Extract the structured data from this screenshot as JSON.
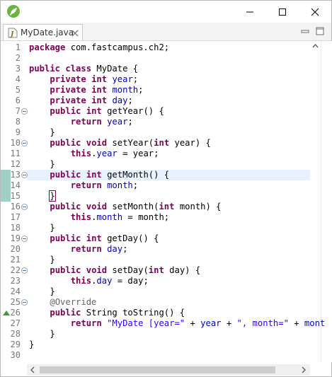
{
  "window": {
    "accent": "#6db33f"
  },
  "editor_tab": {
    "label": "MyDate.java"
  },
  "code_lines": [
    {
      "n": "1",
      "tokens": [
        {
          "t": "package",
          "c": "kw"
        },
        {
          "t": " com.fastcampus.ch2;",
          "c": ""
        }
      ]
    },
    {
      "n": "2",
      "tokens": []
    },
    {
      "n": "3",
      "tokens": [
        {
          "t": "public",
          "c": "kw"
        },
        {
          "t": " ",
          "c": ""
        },
        {
          "t": "class",
          "c": "kw"
        },
        {
          "t": " MyDate {",
          "c": ""
        }
      ]
    },
    {
      "n": "4",
      "tokens": [
        {
          "t": "    ",
          "c": ""
        },
        {
          "t": "private",
          "c": "kw"
        },
        {
          "t": " ",
          "c": ""
        },
        {
          "t": "int",
          "c": "kw"
        },
        {
          "t": " ",
          "c": ""
        },
        {
          "t": "year",
          "c": "fld"
        },
        {
          "t": ";",
          "c": ""
        }
      ]
    },
    {
      "n": "5",
      "tokens": [
        {
          "t": "    ",
          "c": ""
        },
        {
          "t": "private",
          "c": "kw"
        },
        {
          "t": " ",
          "c": ""
        },
        {
          "t": "int",
          "c": "kw"
        },
        {
          "t": " ",
          "c": ""
        },
        {
          "t": "month",
          "c": "fld"
        },
        {
          "t": ";",
          "c": ""
        }
      ]
    },
    {
      "n": "6",
      "tokens": [
        {
          "t": "    ",
          "c": ""
        },
        {
          "t": "private",
          "c": "kw"
        },
        {
          "t": " ",
          "c": ""
        },
        {
          "t": "int",
          "c": "kw"
        },
        {
          "t": " ",
          "c": ""
        },
        {
          "t": "day",
          "c": "fld"
        },
        {
          "t": ";",
          "c": ""
        }
      ]
    },
    {
      "n": "7",
      "fold": true,
      "tokens": [
        {
          "t": "    ",
          "c": ""
        },
        {
          "t": "public",
          "c": "kw"
        },
        {
          "t": " ",
          "c": ""
        },
        {
          "t": "int",
          "c": "kw"
        },
        {
          "t": " getYear() {",
          "c": ""
        }
      ]
    },
    {
      "n": "8",
      "tokens": [
        {
          "t": "        ",
          "c": ""
        },
        {
          "t": "return",
          "c": "kw"
        },
        {
          "t": " ",
          "c": ""
        },
        {
          "t": "year",
          "c": "fld"
        },
        {
          "t": ";",
          "c": ""
        }
      ]
    },
    {
      "n": "9",
      "tokens": [
        {
          "t": "    }",
          "c": ""
        }
      ]
    },
    {
      "n": "10",
      "fold": true,
      "tokens": [
        {
          "t": "    ",
          "c": ""
        },
        {
          "t": "public",
          "c": "kw"
        },
        {
          "t": " ",
          "c": ""
        },
        {
          "t": "void",
          "c": "kw"
        },
        {
          "t": " setYear(",
          "c": ""
        },
        {
          "t": "int",
          "c": "kw"
        },
        {
          "t": " year) {",
          "c": ""
        }
      ]
    },
    {
      "n": "11",
      "tokens": [
        {
          "t": "        ",
          "c": ""
        },
        {
          "t": "this",
          "c": "kw"
        },
        {
          "t": ".",
          "c": ""
        },
        {
          "t": "year",
          "c": "fld"
        },
        {
          "t": " = year;",
          "c": ""
        }
      ]
    },
    {
      "n": "12",
      "tokens": [
        {
          "t": "    }",
          "c": ""
        }
      ]
    },
    {
      "n": "13",
      "fold": true,
      "current": true,
      "changed": true,
      "tokens": [
        {
          "t": "    ",
          "c": ""
        },
        {
          "t": "public",
          "c": "kw"
        },
        {
          "t": " ",
          "c": ""
        },
        {
          "t": "int",
          "c": "kw"
        },
        {
          "t": " getMonth() {",
          "c": ""
        }
      ]
    },
    {
      "n": "14",
      "changed": true,
      "tokens": [
        {
          "t": "        ",
          "c": ""
        },
        {
          "t": "return",
          "c": "kw"
        },
        {
          "t": " ",
          "c": ""
        },
        {
          "t": "month",
          "c": "fld"
        },
        {
          "t": ";",
          "c": ""
        }
      ]
    },
    {
      "n": "15",
      "changed": true,
      "tokens": [
        {
          "t": "    ",
          "c": ""
        },
        {
          "t": "}",
          "c": "cursor"
        }
      ]
    },
    {
      "n": "16",
      "fold": true,
      "tokens": [
        {
          "t": "    ",
          "c": ""
        },
        {
          "t": "public",
          "c": "kw"
        },
        {
          "t": " ",
          "c": ""
        },
        {
          "t": "void",
          "c": "kw"
        },
        {
          "t": " setMonth(",
          "c": ""
        },
        {
          "t": "int",
          "c": "kw"
        },
        {
          "t": " month) {",
          "c": ""
        }
      ]
    },
    {
      "n": "17",
      "tokens": [
        {
          "t": "        ",
          "c": ""
        },
        {
          "t": "this",
          "c": "kw"
        },
        {
          "t": ".",
          "c": ""
        },
        {
          "t": "month",
          "c": "fld"
        },
        {
          "t": " = month;",
          "c": ""
        }
      ]
    },
    {
      "n": "18",
      "tokens": [
        {
          "t": "    }",
          "c": ""
        }
      ]
    },
    {
      "n": "19",
      "fold": true,
      "tokens": [
        {
          "t": "    ",
          "c": ""
        },
        {
          "t": "public",
          "c": "kw"
        },
        {
          "t": " ",
          "c": ""
        },
        {
          "t": "int",
          "c": "kw"
        },
        {
          "t": " getDay() {",
          "c": ""
        }
      ]
    },
    {
      "n": "20",
      "tokens": [
        {
          "t": "        ",
          "c": ""
        },
        {
          "t": "return",
          "c": "kw"
        },
        {
          "t": " ",
          "c": ""
        },
        {
          "t": "day",
          "c": "fld"
        },
        {
          "t": ";",
          "c": ""
        }
      ]
    },
    {
      "n": "21",
      "tokens": [
        {
          "t": "    }",
          "c": ""
        }
      ]
    },
    {
      "n": "22",
      "fold": true,
      "tokens": [
        {
          "t": "    ",
          "c": ""
        },
        {
          "t": "public",
          "c": "kw"
        },
        {
          "t": " ",
          "c": ""
        },
        {
          "t": "void",
          "c": "kw"
        },
        {
          "t": " setDay(",
          "c": ""
        },
        {
          "t": "int",
          "c": "kw"
        },
        {
          "t": " day) {",
          "c": ""
        }
      ]
    },
    {
      "n": "23",
      "tokens": [
        {
          "t": "        ",
          "c": ""
        },
        {
          "t": "this",
          "c": "kw"
        },
        {
          "t": ".",
          "c": ""
        },
        {
          "t": "day",
          "c": "fld"
        },
        {
          "t": " = day;",
          "c": ""
        }
      ]
    },
    {
      "n": "24",
      "tokens": [
        {
          "t": "    }",
          "c": ""
        }
      ]
    },
    {
      "n": "25",
      "fold": true,
      "tokens": [
        {
          "t": "    ",
          "c": ""
        },
        {
          "t": "@Override",
          "c": "ann"
        }
      ]
    },
    {
      "n": "26",
      "override": true,
      "tokens": [
        {
          "t": "    ",
          "c": ""
        },
        {
          "t": "public",
          "c": "kw"
        },
        {
          "t": " String toString() {",
          "c": ""
        }
      ]
    },
    {
      "n": "27",
      "tokens": [
        {
          "t": "        ",
          "c": ""
        },
        {
          "t": "return",
          "c": "kw"
        },
        {
          "t": " ",
          "c": ""
        },
        {
          "t": "\"MyDate [year=\"",
          "c": "str"
        },
        {
          "t": " + ",
          "c": ""
        },
        {
          "t": "year",
          "c": "fld"
        },
        {
          "t": " + ",
          "c": ""
        },
        {
          "t": "\", month=\"",
          "c": "str"
        },
        {
          "t": " + ",
          "c": ""
        },
        {
          "t": "mont",
          "c": "fld"
        }
      ]
    },
    {
      "n": "28",
      "tokens": [
        {
          "t": "    }",
          "c": ""
        }
      ]
    },
    {
      "n": "29",
      "tokens": [
        {
          "t": "}",
          "c": ""
        }
      ]
    },
    {
      "n": "30",
      "tokens": []
    }
  ]
}
